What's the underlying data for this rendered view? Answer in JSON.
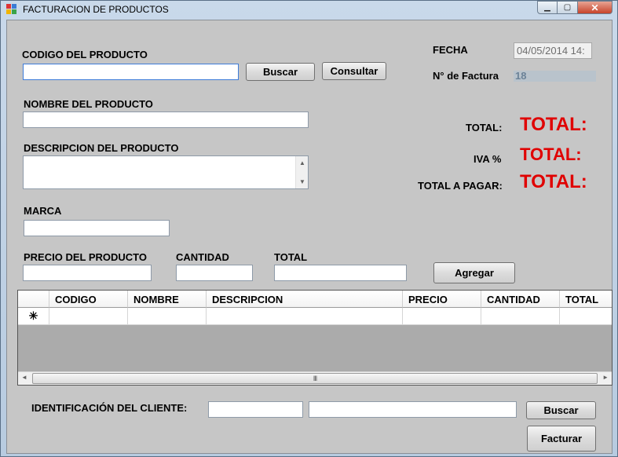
{
  "window": {
    "title": "FACTURACION DE PRODUCTOS",
    "minimize_icon": "minimize-icon",
    "maximize_icon": "maximize-icon",
    "close_icon": "close-icon",
    "close_glyph": "✕",
    "min_glyph": "▁",
    "max_glyph": "▢"
  },
  "product": {
    "codigo_label": "CODIGO DEL PRODUCTO",
    "codigo_value": "",
    "buscar_label": "Buscar",
    "consultar_label": "Consultar",
    "nombre_label": "NOMBRE DEL PRODUCTO",
    "nombre_value": "",
    "descripcion_label": "DESCRIPCION DEL PRODUCTO",
    "descripcion_value": "",
    "marca_label": "MARCA",
    "marca_value": "",
    "precio_label": "PRECIO DEL PRODUCTO",
    "precio_value": "",
    "cantidad_label": "CANTIDAD",
    "cantidad_value": "",
    "total_label": "TOTAL",
    "total_value": "",
    "agregar_label": "Agregar"
  },
  "invoice": {
    "fecha_label": "FECHA",
    "fecha_value": "04/05/2014 14:",
    "factura_label": "N° de Factura",
    "factura_value": "18"
  },
  "totals": {
    "total_label": "TOTAL:",
    "total_value": "TOTAL:",
    "iva_label": "IVA %",
    "iva_value": "TOTAL:",
    "pagar_label": "TOTAL A PAGAR:",
    "pagar_value": "TOTAL:",
    "value_color": "#e00000"
  },
  "grid": {
    "columns": [
      "CODIGO",
      "NOMBRE",
      "DESCRIPCION",
      "PRECIO",
      "CANTIDAD",
      "TOTAL"
    ],
    "new_row_marker": "✳",
    "scroll_grip": "III",
    "scroll_left": "◄",
    "scroll_right": "►"
  },
  "client": {
    "id_label": "IDENTIFICACIÓN DEL CLIENTE:",
    "id_value": "",
    "name_value": "",
    "buscar_label": "Buscar",
    "facturar_label": "Facturar"
  }
}
